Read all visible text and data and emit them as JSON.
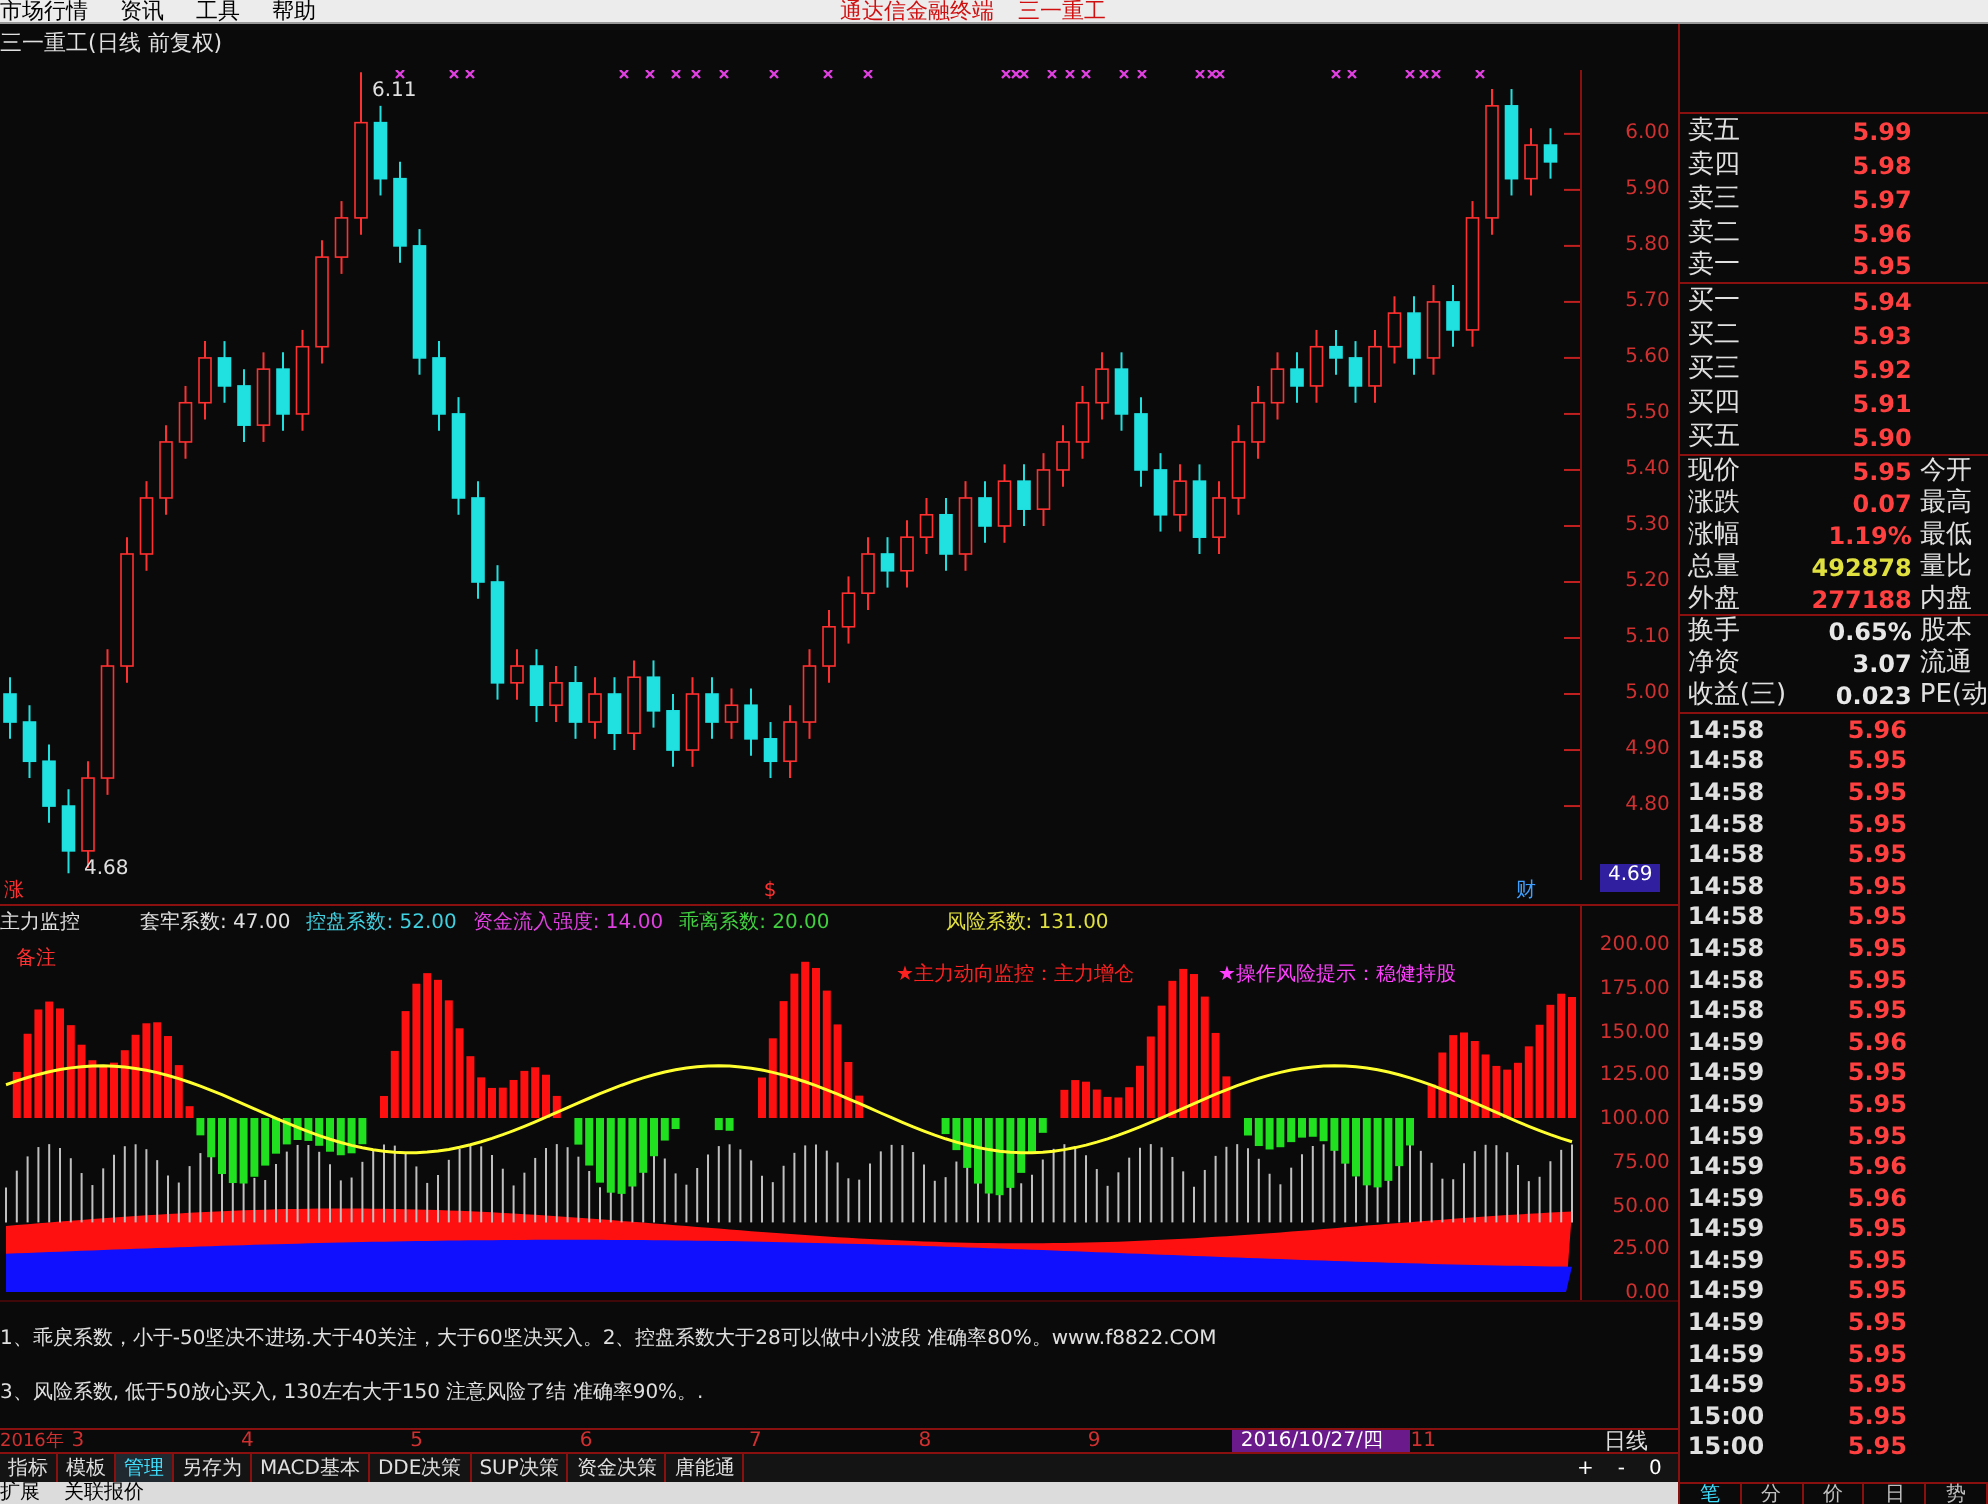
{
  "menu": {
    "items": [
      "市场行情",
      "资讯",
      "工具",
      "帮助"
    ],
    "center_title": "通达信金融终端",
    "stock_name": "三一重工"
  },
  "price_chart": {
    "title": "三一重工(日线 前复权)",
    "high_label": "6.11",
    "low_label": "4.68",
    "current_price": "4.69",
    "chart_data": {
      "type": "candlestick",
      "categories": [
        null,
        null,
        null,
        null,
        null,
        null,
        null,
        null,
        null,
        null,
        null,
        null,
        null,
        null,
        null,
        null,
        null,
        null,
        null,
        null,
        null,
        null,
        null,
        null,
        null,
        null,
        null,
        null,
        null,
        null,
        null,
        null,
        null,
        null,
        null,
        null,
        null,
        null,
        null,
        null,
        null,
        null,
        null,
        null,
        null,
        null,
        null,
        null,
        null,
        null,
        null,
        null,
        null,
        null,
        null,
        null,
        null,
        null,
        null,
        null,
        null,
        null,
        null,
        null,
        null,
        null,
        null,
        null,
        null,
        null,
        null,
        null,
        null,
        null,
        null,
        null,
        null,
        null,
        null,
        null
      ],
      "ohlc": [
        [
          5.0,
          5.03,
          4.92,
          4.95
        ],
        [
          4.95,
          4.98,
          4.85,
          4.88
        ],
        [
          4.88,
          4.91,
          4.77,
          4.8
        ],
        [
          4.8,
          4.83,
          4.68,
          4.72
        ],
        [
          4.72,
          4.88,
          4.69,
          4.85
        ],
        [
          4.85,
          5.08,
          4.82,
          5.05
        ],
        [
          5.05,
          5.28,
          5.02,
          5.25
        ],
        [
          5.25,
          5.38,
          5.22,
          5.35
        ],
        [
          5.35,
          5.48,
          5.32,
          5.45
        ],
        [
          5.45,
          5.55,
          5.42,
          5.52
        ],
        [
          5.52,
          5.63,
          5.49,
          5.6
        ],
        [
          5.6,
          5.63,
          5.52,
          5.55
        ],
        [
          5.55,
          5.58,
          5.45,
          5.48
        ],
        [
          5.48,
          5.61,
          5.45,
          5.58
        ],
        [
          5.58,
          5.61,
          5.47,
          5.5
        ],
        [
          5.5,
          5.65,
          5.47,
          5.62
        ],
        [
          5.62,
          5.81,
          5.59,
          5.78
        ],
        [
          5.78,
          5.88,
          5.75,
          5.85
        ],
        [
          5.85,
          6.11,
          5.82,
          6.02
        ],
        [
          6.02,
          6.05,
          5.89,
          5.92
        ],
        [
          5.92,
          5.95,
          5.77,
          5.8
        ],
        [
          5.8,
          5.83,
          5.57,
          5.6
        ],
        [
          5.6,
          5.63,
          5.47,
          5.5
        ],
        [
          5.5,
          5.53,
          5.32,
          5.35
        ],
        [
          5.35,
          5.38,
          5.17,
          5.2
        ],
        [
          5.2,
          5.23,
          4.99,
          5.02
        ],
        [
          5.02,
          5.08,
          4.99,
          5.05
        ],
        [
          5.05,
          5.08,
          4.95,
          4.98
        ],
        [
          4.98,
          5.05,
          4.95,
          5.02
        ],
        [
          5.02,
          5.05,
          4.92,
          4.95
        ],
        [
          4.95,
          5.03,
          4.92,
          5.0
        ],
        [
          5.0,
          5.03,
          4.9,
          4.93
        ],
        [
          4.93,
          5.06,
          4.9,
          5.03
        ],
        [
          5.03,
          5.06,
          4.94,
          4.97
        ],
        [
          4.97,
          5.0,
          4.87,
          4.9
        ],
        [
          4.9,
          5.03,
          4.87,
          5.0
        ],
        [
          5.0,
          5.03,
          4.92,
          4.95
        ],
        [
          4.95,
          5.01,
          4.92,
          4.98
        ],
        [
          4.98,
          5.01,
          4.89,
          4.92
        ],
        [
          4.92,
          4.95,
          4.85,
          4.88
        ],
        [
          4.88,
          4.98,
          4.85,
          4.95
        ],
        [
          4.95,
          5.08,
          4.92,
          5.05
        ],
        [
          5.05,
          5.15,
          5.02,
          5.12
        ],
        [
          5.12,
          5.21,
          5.09,
          5.18
        ],
        [
          5.18,
          5.28,
          5.15,
          5.25
        ],
        [
          5.25,
          5.28,
          5.19,
          5.22
        ],
        [
          5.22,
          5.31,
          5.19,
          5.28
        ],
        [
          5.28,
          5.35,
          5.25,
          5.32
        ],
        [
          5.32,
          5.35,
          5.22,
          5.25
        ],
        [
          5.25,
          5.38,
          5.22,
          5.35
        ],
        [
          5.35,
          5.38,
          5.27,
          5.3
        ],
        [
          5.3,
          5.41,
          5.27,
          5.38
        ],
        [
          5.38,
          5.41,
          5.3,
          5.33
        ],
        [
          5.33,
          5.43,
          5.3,
          5.4
        ],
        [
          5.4,
          5.48,
          5.37,
          5.45
        ],
        [
          5.45,
          5.55,
          5.42,
          5.52
        ],
        [
          5.52,
          5.61,
          5.49,
          5.58
        ],
        [
          5.58,
          5.61,
          5.47,
          5.5
        ],
        [
          5.5,
          5.53,
          5.37,
          5.4
        ],
        [
          5.4,
          5.43,
          5.29,
          5.32
        ],
        [
          5.32,
          5.41,
          5.29,
          5.38
        ],
        [
          5.38,
          5.41,
          5.25,
          5.28
        ],
        [
          5.28,
          5.38,
          5.25,
          5.35
        ],
        [
          5.35,
          5.48,
          5.32,
          5.45
        ],
        [
          5.45,
          5.55,
          5.42,
          5.52
        ],
        [
          5.52,
          5.61,
          5.49,
          5.58
        ],
        [
          5.58,
          5.61,
          5.52,
          5.55
        ],
        [
          5.55,
          5.65,
          5.52,
          5.62
        ],
        [
          5.62,
          5.65,
          5.57,
          5.6
        ],
        [
          5.6,
          5.63,
          5.52,
          5.55
        ],
        [
          5.55,
          5.65,
          5.52,
          5.62
        ],
        [
          5.62,
          5.71,
          5.59,
          5.68
        ],
        [
          5.68,
          5.71,
          5.57,
          5.6
        ],
        [
          5.6,
          5.73,
          5.57,
          5.7
        ],
        [
          5.7,
          5.73,
          5.62,
          5.65
        ],
        [
          5.65,
          5.88,
          5.62,
          5.85
        ],
        [
          5.85,
          6.08,
          5.82,
          6.05
        ],
        [
          6.05,
          6.08,
          5.89,
          5.92
        ],
        [
          5.92,
          6.01,
          5.89,
          5.98
        ],
        [
          5.98,
          6.01,
          5.92,
          5.95
        ]
      ],
      "ylim": [
        4.668,
        6.114
      ],
      "yticks": [
        {
          "value": 6.0,
          "label": "6.00"
        },
        {
          "value": 5.9,
          "label": "5.90"
        },
        {
          "value": 5.8,
          "label": "5.80"
        },
        {
          "value": 5.7,
          "label": "5.70"
        },
        {
          "value": 5.6,
          "label": "5.60"
        },
        {
          "value": 5.5,
          "label": "5.50"
        },
        {
          "value": 5.4,
          "label": "5.40"
        },
        {
          "value": 5.3,
          "label": "5.30"
        },
        {
          "value": 5.2,
          "label": "5.20"
        },
        {
          "value": 5.1,
          "label": "5.10"
        },
        {
          "value": 5.0,
          "label": "5.00"
        },
        {
          "value": 4.9,
          "label": "4.90"
        },
        {
          "value": 4.8,
          "label": "4.80"
        }
      ]
    },
    "markers": [
      {
        "text": "涨",
        "kind": "up"
      },
      {
        "text": "$",
        "kind": "up"
      },
      {
        "text": "财",
        "kind": "info"
      }
    ]
  },
  "indicator": {
    "name": "主力监控",
    "note": "备注",
    "params": [
      {
        "label": "套牢系数: 47.00",
        "color": "#e0e0e0"
      },
      {
        "label": "控盘系数: 52.00",
        "color": "#40d0e0"
      },
      {
        "label": "资金流入强度: 14.00",
        "color": "#e040e0"
      },
      {
        "label": "乖离系数: 20.00",
        "color": "#40d040"
      },
      {
        "label": "风险系数: 131.00",
        "color": "#e0e040"
      }
    ],
    "signals": [
      {
        "text": "★主力动向监控：主力增仓",
        "color": "#ff2020"
      },
      {
        "text": "★操作风险提示：稳健持股",
        "color": "#ff40ff"
      }
    ],
    "axis": [
      "200.00",
      "175.00",
      "150.00",
      "125.00",
      "100.00",
      "75.00",
      "50.00",
      "25.00",
      "0.00"
    ]
  },
  "notes": [
    "1、乖戾系数，小于-50坚决不进场.大于40关注，大于60坚决买入。2、控盘系数大于28可以做中小波段 准确率80%。www.f8822.COM",
    "3、风险系数, 低于50放心买入, 130左右大于150 注意风险了结 准确率90%。."
  ],
  "date_axis": {
    "labels": [
      {
        "label": "2016年",
        "highlighted": false
      },
      {
        "label": "3",
        "highlighted": false
      },
      {
        "label": "4",
        "highlighted": false
      },
      {
        "label": "5",
        "highlighted": false
      },
      {
        "label": "6",
        "highlighted": false
      },
      {
        "label": "7",
        "highlighted": false
      },
      {
        "label": "8",
        "highlighted": false
      },
      {
        "label": "9",
        "highlighted": false
      },
      {
        "label": "2016/10/27/四",
        "highlighted": true
      },
      {
        "label": "11",
        "highlighted": false
      }
    ],
    "period": "日线"
  },
  "bottom_tabs": [
    {
      "label": "指标",
      "selected": false
    },
    {
      "label": "模板",
      "selected": false
    },
    {
      "label": "管理",
      "selected": true
    },
    {
      "label": "另存为",
      "selected": false
    },
    {
      "label": "MACD基本",
      "selected": false
    },
    {
      "label": "DDE决策",
      "selected": false
    },
    {
      "label": "SUP决策",
      "selected": false
    },
    {
      "label": "资金决策",
      "selected": false
    },
    {
      "label": "唐能通",
      "selected": false
    }
  ],
  "zoom_buttons": [
    "+",
    "-",
    "0"
  ],
  "bottom_row": [
    "扩展",
    "关联报价"
  ],
  "quote_panel": {
    "order_book": [
      {
        "label": "卖五",
        "price": "5.99"
      },
      {
        "label": "卖四",
        "price": "5.98"
      },
      {
        "label": "卖三",
        "price": "5.97"
      },
      {
        "label": "卖二",
        "price": "5.96"
      },
      {
        "label": "卖一",
        "price": "5.95"
      },
      {
        "label": "买一",
        "price": "5.94"
      },
      {
        "label": "买二",
        "price": "5.93"
      },
      {
        "label": "买三",
        "price": "5.92"
      },
      {
        "label": "买四",
        "price": "5.91"
      },
      {
        "label": "买五",
        "price": "5.90"
      }
    ],
    "stats": [
      {
        "label": "现价",
        "value": "5.95",
        "kind": "up",
        "label2": "今开"
      },
      {
        "label": "涨跌",
        "value": "0.07",
        "kind": "up",
        "label2": "最高"
      },
      {
        "label": "涨幅",
        "value": "1.19%",
        "kind": "up",
        "label2": "最低"
      },
      {
        "label": "总量",
        "value": "492878",
        "kind": "volume",
        "label2": "量比"
      },
      {
        "label": "外盘",
        "value": "277188",
        "kind": "up",
        "label2": "内盘"
      },
      {
        "label": "换手",
        "value": "0.65%",
        "kind": "plain",
        "label2": "股本"
      },
      {
        "label": "净资",
        "value": "3.07",
        "kind": "plain",
        "label2": "流通"
      },
      {
        "label": "收益(三)",
        "value": "0.023",
        "kind": "plain",
        "label2": "PE(动"
      }
    ],
    "ticks": [
      {
        "time": "14:58",
        "price": "5.96"
      },
      {
        "time": "14:58",
        "price": "5.95"
      },
      {
        "time": "14:58",
        "price": "5.95"
      },
      {
        "time": "14:58",
        "price": "5.95"
      },
      {
        "time": "14:58",
        "price": "5.95"
      },
      {
        "time": "14:58",
        "price": "5.95"
      },
      {
        "time": "14:58",
        "price": "5.95"
      },
      {
        "time": "14:58",
        "price": "5.95"
      },
      {
        "time": "14:58",
        "price": "5.95"
      },
      {
        "time": "14:58",
        "price": "5.95"
      },
      {
        "time": "14:59",
        "price": "5.96"
      },
      {
        "time": "14:59",
        "price": "5.95"
      },
      {
        "time": "14:59",
        "price": "5.95"
      },
      {
        "time": "14:59",
        "price": "5.95"
      },
      {
        "time": "14:59",
        "price": "5.96"
      },
      {
        "time": "14:59",
        "price": "5.96"
      },
      {
        "time": "14:59",
        "price": "5.95"
      },
      {
        "time": "14:59",
        "price": "5.95"
      },
      {
        "time": "14:59",
        "price": "5.95"
      },
      {
        "time": "14:59",
        "price": "5.95"
      },
      {
        "time": "14:59",
        "price": "5.95"
      },
      {
        "time": "14:59",
        "price": "5.95"
      },
      {
        "time": "15:00",
        "price": "5.95"
      },
      {
        "time": "15:00",
        "price": "5.95"
      }
    ],
    "tabs": [
      {
        "label": "笔",
        "selected": true
      },
      {
        "label": "分",
        "selected": false
      },
      {
        "label": "价",
        "selected": false
      },
      {
        "label": "日",
        "selected": false
      },
      {
        "label": "势",
        "selected": false
      }
    ]
  }
}
